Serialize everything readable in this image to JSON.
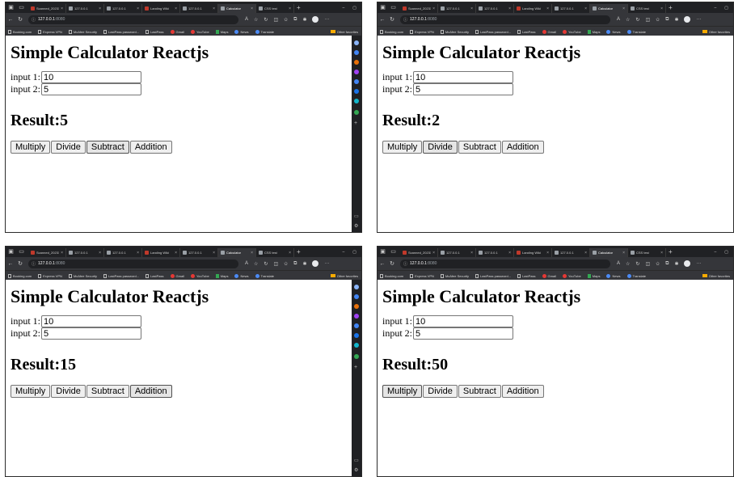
{
  "browser": {
    "tabs": [
      {
        "title": "Scanned_20231",
        "icon": "doc-red"
      },
      {
        "title": "127.0.0.1",
        "icon": "globe"
      },
      {
        "title": "127.0.0.1",
        "icon": "globe"
      },
      {
        "title": "Landing Wiki",
        "icon": "page-red"
      },
      {
        "title": "127.0.0.1",
        "icon": "globe"
      },
      {
        "title": "Calculator",
        "icon": "page"
      },
      {
        "title": "CSS test",
        "icon": "page"
      }
    ],
    "active_tab_index": 5,
    "url_host": "127.0.0.1",
    "url_port": ":8080",
    "bookmarks": [
      "Booking.com",
      "Express VPN",
      "McAfee Security",
      "LastPass password...",
      "LastPass",
      "Gmail",
      "YouTube",
      "Maps",
      "News",
      "Translate"
    ],
    "other_favorites": "Other favorites"
  },
  "app": {
    "title": "Simple Calculator Reactjs",
    "input1_label": "input 1:",
    "input2_label": "input 2:",
    "input1_value": "10",
    "input2_value": "5",
    "result_prefix": "Result:",
    "buttons": {
      "multiply": "Multiply",
      "divide": "Divide",
      "subtract": "Subtract",
      "addition": "Addition"
    }
  },
  "panels": [
    {
      "result": "5",
      "hovered_button": "subtract",
      "show_sidebar": true
    },
    {
      "result": "2",
      "hovered_button": "divide",
      "show_sidebar": false
    },
    {
      "result": "15",
      "hovered_button": "addition",
      "show_sidebar": true
    },
    {
      "result": "50",
      "hovered_button": "multiply",
      "show_sidebar": false
    }
  ],
  "colors": {
    "chrome_dark": "#202124",
    "toolbar": "#35363a",
    "button_bg": "#efefef",
    "button_border": "#767676"
  }
}
